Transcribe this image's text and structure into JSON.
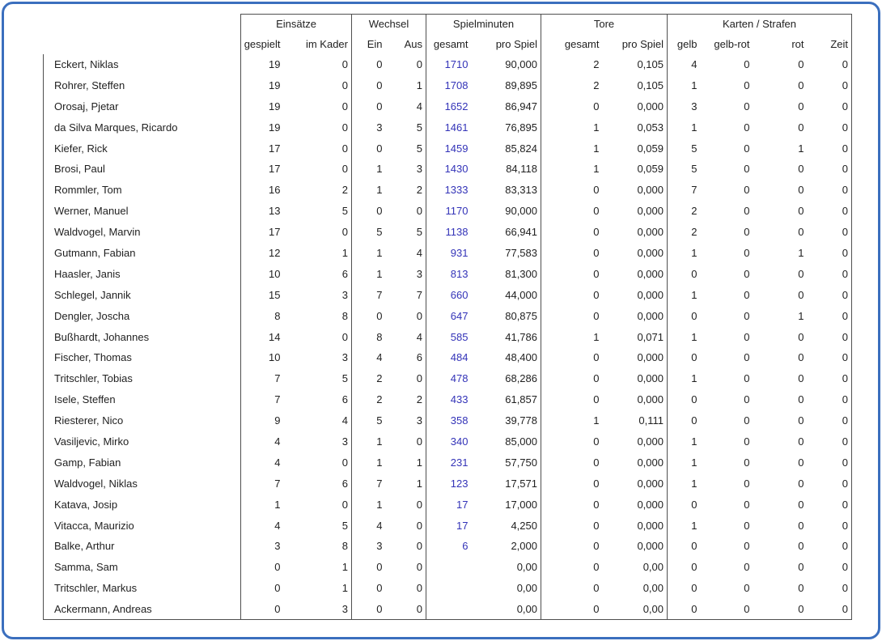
{
  "window": {
    "border_color": "#3b6fbe",
    "background": "#ffffff"
  },
  "table": {
    "groups": [
      {
        "label": "Einsätze"
      },
      {
        "label": "Wechsel"
      },
      {
        "label": "Spielminuten"
      },
      {
        "label": "Tore"
      },
      {
        "label": "Karten / Strafen"
      }
    ],
    "subheaders": {
      "einsaetze_gespielt": "gespielt",
      "einsaetze_im_kader": "im Kader",
      "wechsel_ein": "Ein",
      "wechsel_aus": "Aus",
      "spielminuten_gesamt": "gesamt",
      "spielminuten_pro_spiel": "pro Spiel",
      "tore_gesamt": "gesamt",
      "tore_pro_spiel": "pro Spiel",
      "karten_gelb": "gelb",
      "karten_gelb_rot": "gelb-rot",
      "karten_rot": "rot",
      "karten_zeit": "Zeit"
    },
    "minutes_text_color": "#3333b8",
    "rows": [
      [
        "Eckert, Niklas",
        "19",
        "0",
        "0",
        "0",
        "1710",
        "90,000",
        "2",
        "0,105",
        "4",
        "0",
        "0",
        "0"
      ],
      [
        "Rohrer, Steffen",
        "19",
        "0",
        "0",
        "1",
        "1708",
        "89,895",
        "2",
        "0,105",
        "1",
        "0",
        "0",
        "0"
      ],
      [
        "Orosaj, Pjetar",
        "19",
        "0",
        "0",
        "4",
        "1652",
        "86,947",
        "0",
        "0,000",
        "3",
        "0",
        "0",
        "0"
      ],
      [
        "da Silva Marques, Ricardo",
        "19",
        "0",
        "3",
        "5",
        "1461",
        "76,895",
        "1",
        "0,053",
        "1",
        "0",
        "0",
        "0"
      ],
      [
        "Kiefer, Rick",
        "17",
        "0",
        "0",
        "5",
        "1459",
        "85,824",
        "1",
        "0,059",
        "5",
        "0",
        "1",
        "0"
      ],
      [
        "Brosi, Paul",
        "17",
        "0",
        "1",
        "3",
        "1430",
        "84,118",
        "1",
        "0,059",
        "5",
        "0",
        "0",
        "0"
      ],
      [
        "Rommler, Tom",
        "16",
        "2",
        "1",
        "2",
        "1333",
        "83,313",
        "0",
        "0,000",
        "7",
        "0",
        "0",
        "0"
      ],
      [
        "Werner, Manuel",
        "13",
        "5",
        "0",
        "0",
        "1170",
        "90,000",
        "0",
        "0,000",
        "2",
        "0",
        "0",
        "0"
      ],
      [
        "Waldvogel, Marvin",
        "17",
        "0",
        "5",
        "5",
        "1138",
        "66,941",
        "0",
        "0,000",
        "2",
        "0",
        "0",
        "0"
      ],
      [
        "Gutmann, Fabian",
        "12",
        "1",
        "1",
        "4",
        "931",
        "77,583",
        "0",
        "0,000",
        "1",
        "0",
        "1",
        "0"
      ],
      [
        "Haasler, Janis",
        "10",
        "6",
        "1",
        "3",
        "813",
        "81,300",
        "0",
        "0,000",
        "0",
        "0",
        "0",
        "0"
      ],
      [
        "Schlegel, Jannik",
        "15",
        "3",
        "7",
        "7",
        "660",
        "44,000",
        "0",
        "0,000",
        "1",
        "0",
        "0",
        "0"
      ],
      [
        "Dengler, Joscha",
        "8",
        "8",
        "0",
        "0",
        "647",
        "80,875",
        "0",
        "0,000",
        "0",
        "0",
        "1",
        "0"
      ],
      [
        "Bußhardt, Johannes",
        "14",
        "0",
        "8",
        "4",
        "585",
        "41,786",
        "1",
        "0,071",
        "1",
        "0",
        "0",
        "0"
      ],
      [
        "Fischer, Thomas",
        "10",
        "3",
        "4",
        "6",
        "484",
        "48,400",
        "0",
        "0,000",
        "0",
        "0",
        "0",
        "0"
      ],
      [
        "Tritschler, Tobias",
        "7",
        "5",
        "2",
        "0",
        "478",
        "68,286",
        "0",
        "0,000",
        "1",
        "0",
        "0",
        "0"
      ],
      [
        "Isele, Steffen",
        "7",
        "6",
        "2",
        "2",
        "433",
        "61,857",
        "0",
        "0,000",
        "0",
        "0",
        "0",
        "0"
      ],
      [
        "Riesterer, Nico",
        "9",
        "4",
        "5",
        "3",
        "358",
        "39,778",
        "1",
        "0,111",
        "0",
        "0",
        "0",
        "0"
      ],
      [
        "Vasiljevic, Mirko",
        "4",
        "3",
        "1",
        "0",
        "340",
        "85,000",
        "0",
        "0,000",
        "1",
        "0",
        "0",
        "0"
      ],
      [
        "Gamp, Fabian",
        "4",
        "0",
        "1",
        "1",
        "231",
        "57,750",
        "0",
        "0,000",
        "1",
        "0",
        "0",
        "0"
      ],
      [
        "Waldvogel, Niklas",
        "7",
        "6",
        "7",
        "1",
        "123",
        "17,571",
        "0",
        "0,000",
        "1",
        "0",
        "0",
        "0"
      ],
      [
        "Katava, Josip",
        "1",
        "0",
        "1",
        "0",
        "17",
        "17,000",
        "0",
        "0,000",
        "0",
        "0",
        "0",
        "0"
      ],
      [
        "Vitacca, Maurizio",
        "4",
        "5",
        "4",
        "0",
        "17",
        "4,250",
        "0",
        "0,000",
        "1",
        "0",
        "0",
        "0"
      ],
      [
        "Balke, Arthur",
        "3",
        "8",
        "3",
        "0",
        "6",
        "2,000",
        "0",
        "0,000",
        "0",
        "0",
        "0",
        "0"
      ],
      [
        "Samma, Sam",
        "0",
        "1",
        "0",
        "0",
        "",
        "0,00",
        "0",
        "0,00",
        "0",
        "0",
        "0",
        "0"
      ],
      [
        "Tritschler, Markus",
        "0",
        "1",
        "0",
        "0",
        "",
        "0,00",
        "0",
        "0,00",
        "0",
        "0",
        "0",
        "0"
      ],
      [
        "Ackermann, Andreas",
        "0",
        "3",
        "0",
        "0",
        "",
        "0,00",
        "0",
        "0,00",
        "0",
        "0",
        "0",
        "0"
      ]
    ]
  }
}
